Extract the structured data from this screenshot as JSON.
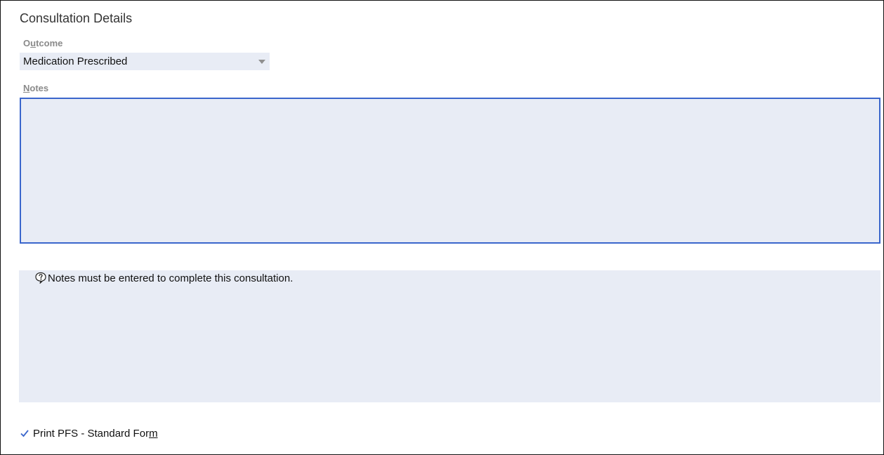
{
  "section": {
    "title": "Consultation Details"
  },
  "outcome": {
    "label_prefix": "O",
    "label_accel": "u",
    "label_suffix": "tcome",
    "selected": "Medication Prescribed"
  },
  "notes": {
    "label_accel": "N",
    "label_suffix": "otes",
    "value": ""
  },
  "validation": {
    "icon": "question-bubble-icon",
    "message": "Notes must be entered to complete this consultation."
  },
  "print_option": {
    "checked": true,
    "label_main": "Print PFS - Standard For",
    "label_accel": "m"
  },
  "colors": {
    "field_bg": "#e8ecf5",
    "focus_border": "#3a66cc",
    "check": "#3a66cc"
  }
}
